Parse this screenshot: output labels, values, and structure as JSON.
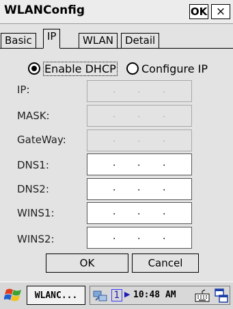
{
  "window": {
    "title": "WLANConfig",
    "ok_label": "OK",
    "close_label": "×"
  },
  "tabs": [
    {
      "label": "Basic",
      "active": false
    },
    {
      "label": "IP",
      "active": true
    },
    {
      "label": "WLAN",
      "active": false
    },
    {
      "label": "Detail",
      "active": false
    }
  ],
  "ip_mode": {
    "enable_dhcp_label": "Enable DHCP",
    "configure_ip_label": "Configure IP",
    "selected": "Enable DHCP"
  },
  "fields": [
    {
      "label": "IP:",
      "enabled": false
    },
    {
      "label": "MASK:",
      "enabled": false
    },
    {
      "label": "GateWay:",
      "enabled": false
    },
    {
      "label": "DNS1:",
      "enabled": true
    },
    {
      "label": "DNS2:",
      "enabled": true
    },
    {
      "label": "WINS1:",
      "enabled": true
    },
    {
      "label": "WINS2:",
      "enabled": true
    }
  ],
  "buttons": {
    "ok_label": "OK",
    "cancel_label": "Cancel"
  },
  "taskbar": {
    "task_label": "WLANC...",
    "desktop_number": "1",
    "clock": "10:48 AM",
    "icons": [
      "windows-start-icon",
      "network-icon",
      "keyboard-icon",
      "switch-windows-icon"
    ]
  },
  "colors": {
    "background": "#e3e3e3",
    "accent_blue": "#1a1ab5"
  }
}
